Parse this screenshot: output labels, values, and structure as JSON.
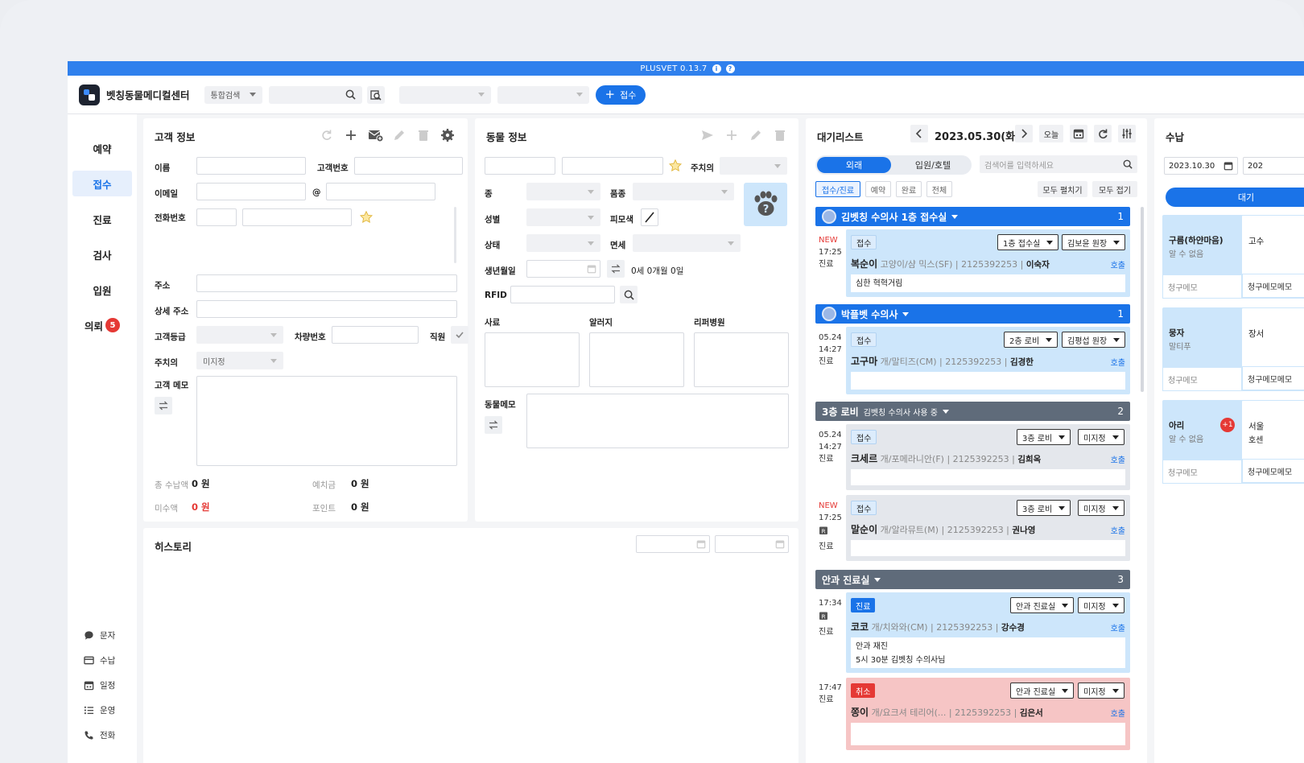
{
  "app": {
    "version": "PLUSVET 0.13.7",
    "clinic_name": "벳칭동물메디컬센터"
  },
  "topbar": {
    "search_scope": "통합검색",
    "reception_button": "접수"
  },
  "sidebar": {
    "items": [
      {
        "label": "예약"
      },
      {
        "label": "접수"
      },
      {
        "label": "진료"
      },
      {
        "label": "검사"
      },
      {
        "label": "입원"
      },
      {
        "label": "의뢰",
        "badge": "5"
      }
    ],
    "bottom": [
      {
        "label": "문자"
      },
      {
        "label": "수납"
      },
      {
        "label": "일정"
      },
      {
        "label": "운영"
      },
      {
        "label": "전화"
      }
    ]
  },
  "customer": {
    "title": "고객 정보",
    "name_label": "이름",
    "id_label": "고객번호",
    "email_label": "이메일",
    "at": "@",
    "phone_label": "전화번호",
    "address_label": "주소",
    "address_detail_label": "상세 주소",
    "grade_label": "고객등급",
    "car_label": "차량번호",
    "staff_label": "직원",
    "vet_label": "주치의",
    "vet_value": "미지정",
    "memo_label": "고객 메모",
    "total_label": "총 수납액",
    "total_value": "0 원",
    "deposit_label": "예치금",
    "deposit_value": "0 원",
    "unpaid_label": "미수액",
    "unpaid_value": "0 원",
    "point_label": "포인트",
    "point_value": "0 원"
  },
  "animal": {
    "title": "동물 정보",
    "vet_label": "주치의",
    "species_label": "종",
    "breed_label": "품종",
    "sex_label": "성별",
    "coat_label": "피모색",
    "status_label": "상태",
    "immunity_label": "면세",
    "birth_label": "생년월일",
    "age_value": "0세 0개월 0일",
    "rfid_label": "RFID",
    "cause_label": "사료",
    "allergy_label": "알러지",
    "referral_label": "리퍼병원",
    "memo_label": "동물메모"
  },
  "history": {
    "title": "히스토리"
  },
  "waitlist": {
    "title": "대기리스트",
    "date": "2023.05.30(화)",
    "today": "오늘",
    "tab_out": "외래",
    "tab_in": "입원/호텔",
    "search_placeholder": "검색어를 입력하세요",
    "filters": [
      "접수/진료",
      "예약",
      "완료",
      "전체"
    ],
    "expand_all": "모두 펼치기",
    "collapse_all": "모두 접기",
    "groups": [
      {
        "title": "김벳칭 수의사 1층 접수실",
        "count": "1",
        "cards": [
          {
            "new": "NEW",
            "time": "17:25",
            "state": "진료",
            "status": "접수",
            "room": "1층 접수실",
            "vet": "김보윤 원장",
            "name": "복순이",
            "info": "고양이/샴 믹스(SF) | 2125392253 |",
            "owner": "이숙자",
            "call": "호출",
            "memo": "심한 혁혁거림"
          }
        ]
      },
      {
        "title": "박플벳 수의사",
        "count": "1",
        "cards": [
          {
            "date": "05.24",
            "time": "14:27",
            "state": "진료",
            "status": "접수",
            "room": "2층 로비",
            "vet": "김평섭 원장",
            "name": "고구마",
            "info": "개/말티즈(CM) | 2125392253 |",
            "owner": "김경한",
            "call": "호출"
          }
        ]
      },
      {
        "title": "3층 로비",
        "sub": "김벳칭 수의사 사용 중",
        "count": "2",
        "cards": [
          {
            "date": "05.24",
            "time": "14:27",
            "state": "진료",
            "status": "접수",
            "room": "3층 로비",
            "vet": "미지정",
            "name": "크세르",
            "info": "개/포메라니안(F) | 2125392253 |",
            "owner": "김희옥",
            "call": "호출"
          },
          {
            "new": "NEW",
            "time": "17:25",
            "state": "진료",
            "status": "접수",
            "room": "3층 로비",
            "vet": "미지정",
            "name": "말순이",
            "info": "개/알라뮤트(M) | 2125392253 |",
            "owner": "권나영",
            "call": "호출"
          }
        ]
      },
      {
        "title": "안과 진료실",
        "count": "3",
        "cards": [
          {
            "time": "17:34",
            "state": "진료",
            "status": "진료",
            "room": "안과 진료실",
            "vet": "미지정",
            "name": "코코",
            "info": "개/치와와(CM) | 2125392253 |",
            "owner": "강수경",
            "call": "호출",
            "memo1": "안과 재진",
            "memo2": "5시 30분 김벳칭 수의사님"
          },
          {
            "time": "17:47",
            "state": "진료",
            "status": "취소",
            "room": "안과 진료실",
            "vet": "미지정",
            "name": "쫑이",
            "info": "개/요크셔 테리어(... | 2125392253 |",
            "owner": "김은서",
            "call": "호출"
          }
        ]
      }
    ]
  },
  "payment": {
    "title": "수납",
    "date": "2023.10.30",
    "date2": "202",
    "tab": "대기",
    "cards": [
      {
        "name": "구름(하얀마음)",
        "sub": "알 수 없음",
        "right": "고수",
        "memo": "청구메모",
        "memo2": "청구메모메모"
      },
      {
        "name": "뭉자",
        "sub": "말티푸",
        "right": "장서",
        "memo": "청구메모",
        "memo2": "청구메모메모"
      },
      {
        "name": "아리",
        "sub": "알 수 없음",
        "badge": "+1",
        "right": "서울",
        "right2": "호센",
        "memo": "청구메모",
        "memo2": "청구메모메모"
      }
    ]
  }
}
